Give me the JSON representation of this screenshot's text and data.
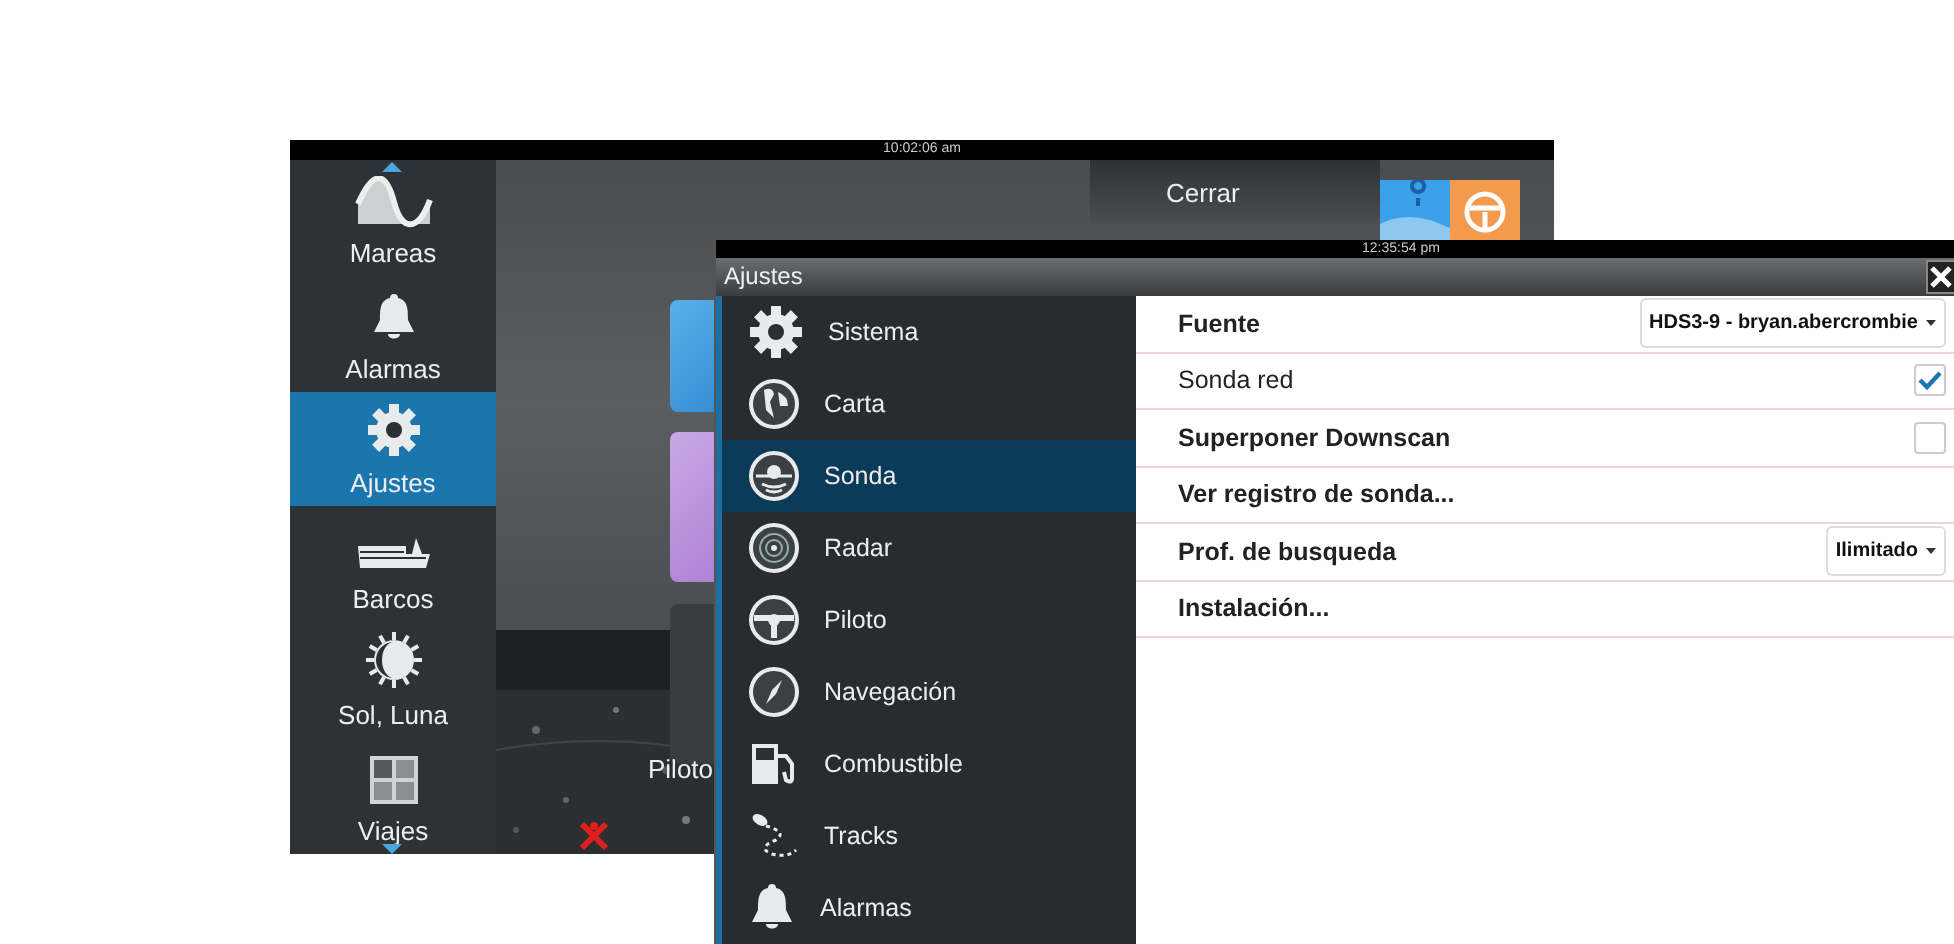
{
  "back_screen": {
    "status_time": "10:02:06 am",
    "sidebar": {
      "items": [
        {
          "label": "Mareas",
          "selected": false
        },
        {
          "label": "Alarmas",
          "selected": false
        },
        {
          "label": "Ajustes",
          "selected": true
        },
        {
          "label": "Barcos",
          "selected": false
        },
        {
          "label": "Sol, Luna",
          "selected": false
        },
        {
          "label": "Viajes",
          "selected": false
        }
      ]
    },
    "close_label": "Cerrar",
    "tile_label": "Piloto"
  },
  "front_screen": {
    "status_time": "12:35:54 pm",
    "title": "Ajustes",
    "menu": {
      "items": [
        {
          "label": "Sistema",
          "selected": false
        },
        {
          "label": "Carta",
          "selected": false
        },
        {
          "label": "Sonda",
          "selected": true
        },
        {
          "label": "Radar",
          "selected": false
        },
        {
          "label": "Piloto",
          "selected": false
        },
        {
          "label": "Navegación",
          "selected": false
        },
        {
          "label": "Combustible",
          "selected": false
        },
        {
          "label": "Tracks",
          "selected": false
        },
        {
          "label": "Alarmas",
          "selected": false
        }
      ]
    },
    "settings": [
      {
        "kind": "dropdown",
        "label": "Fuente",
        "value": "HDS3-9 - bryan.abercrombie"
      },
      {
        "kind": "checkbox",
        "label": "Sonda red",
        "checked": true
      },
      {
        "kind": "checkbox",
        "label": "Superponer Downscan",
        "checked": false
      },
      {
        "kind": "link",
        "label": "Ver registro de sonda..."
      },
      {
        "kind": "dropdown",
        "label": "Prof. de busqueda",
        "value": "Ilimitado"
      },
      {
        "kind": "link",
        "label": "Instalación..."
      }
    ]
  }
}
